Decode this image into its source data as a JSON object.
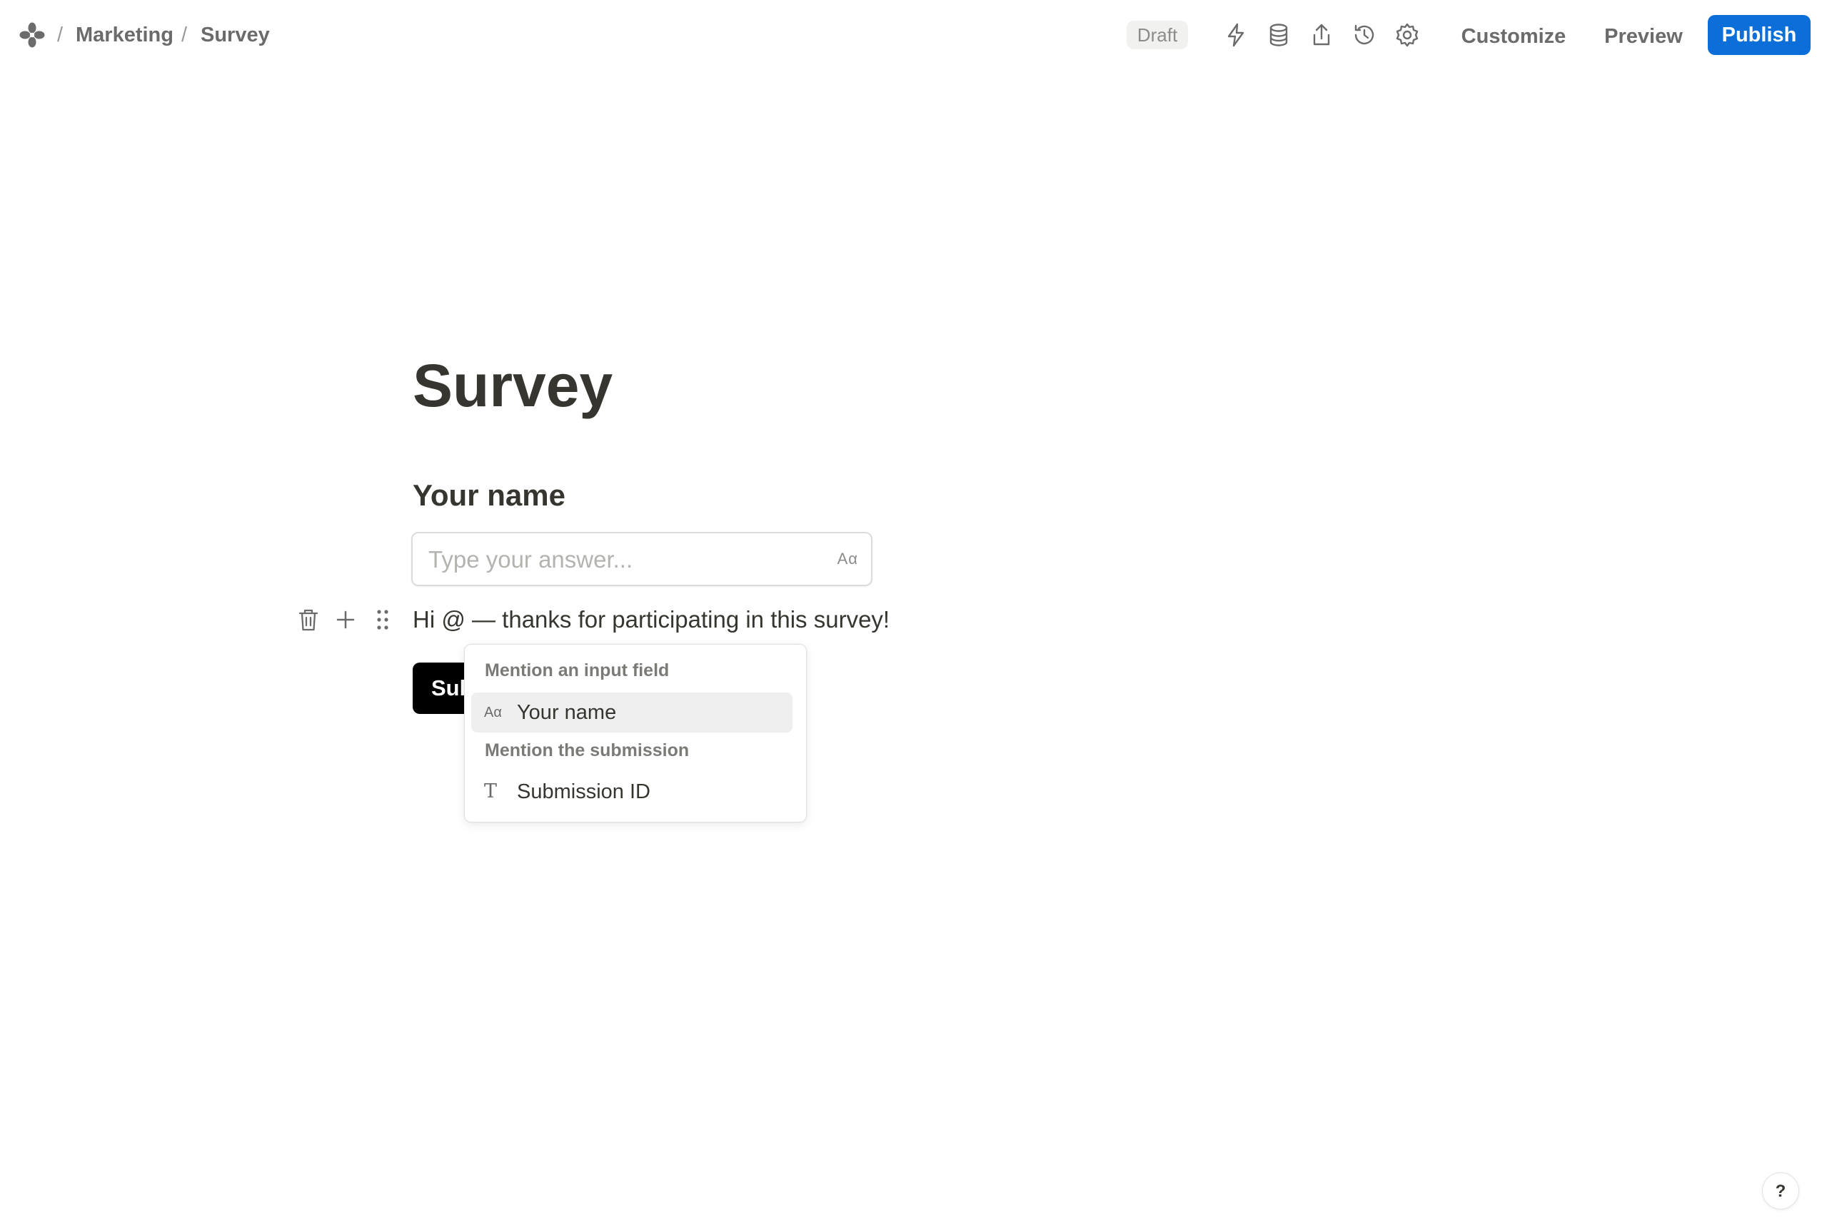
{
  "breadcrumb": {
    "workspace_icon": "workspace-logo-icon",
    "items": [
      "Marketing",
      "Survey"
    ],
    "separator": "/"
  },
  "header": {
    "status_badge": "Draft",
    "icons": [
      "lightning-icon",
      "database-icon",
      "share-icon",
      "history-icon",
      "gear-icon"
    ],
    "customize_label": "Customize",
    "preview_label": "Preview",
    "publish_label": "Publish",
    "publish_color": "#0b6ed9"
  },
  "form": {
    "title": "Survey",
    "field_label": "Your name",
    "input_placeholder": "Type your answer...",
    "input_type_icon": "Aα",
    "text_block": "Hi @ — thanks for participating in this survey!",
    "submit_label_visible": "Submit"
  },
  "mention_menu": {
    "section_input": "Mention an input field",
    "input_item_icon": "Aα",
    "input_item_label": "Your name",
    "section_submission": "Mention the submission",
    "submission_item_icon": "T",
    "submission_item_label": "Submission ID"
  },
  "help": {
    "label": "?"
  }
}
